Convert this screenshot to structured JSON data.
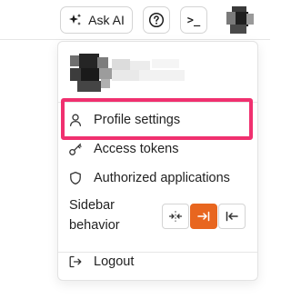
{
  "header": {
    "ask_ai_label": "Ask AI",
    "help_icon": "help-circle-icon",
    "terminal_glyph": ">_"
  },
  "menu": {
    "items": [
      {
        "label": "Profile settings",
        "icon": "user-icon"
      },
      {
        "label": "Access tokens",
        "icon": "key-icon"
      },
      {
        "label": "Authorized applications",
        "icon": "shield-icon"
      }
    ],
    "sidebar_behavior": {
      "label_line1": "Sidebar",
      "label_line2": "behavior",
      "options": [
        {
          "icon": "expand-horizontal-icon",
          "active": false
        },
        {
          "icon": "collapse-to-right-icon",
          "active": true
        },
        {
          "icon": "collapse-to-left-icon",
          "active": false
        }
      ]
    },
    "logout_label": "Logout"
  },
  "colors": {
    "accent": "#e8661f",
    "highlight": "#f0306f"
  }
}
